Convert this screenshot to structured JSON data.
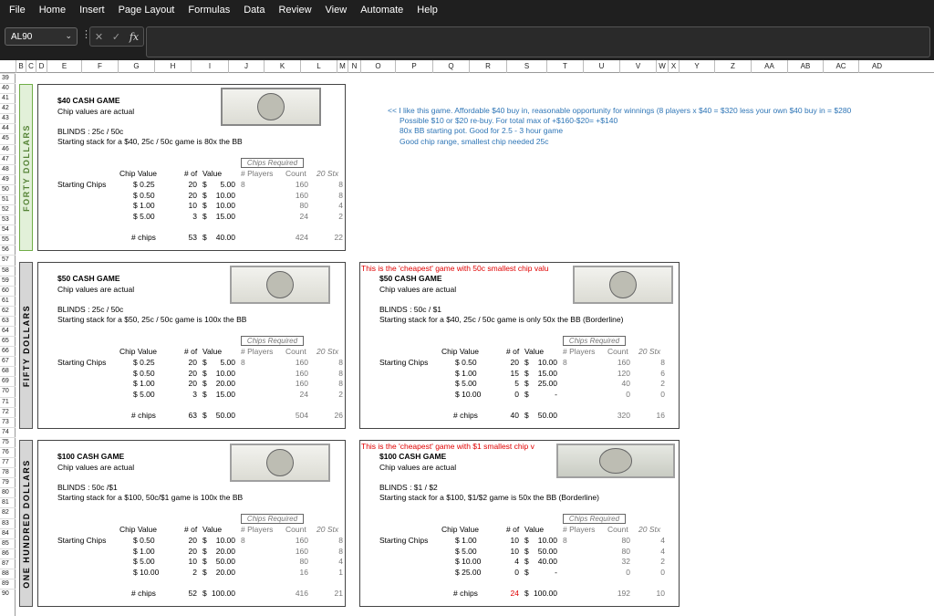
{
  "menu": [
    "File",
    "Home",
    "Insert",
    "Page Layout",
    "Formulas",
    "Data",
    "Review",
    "View",
    "Automate",
    "Help"
  ],
  "formula_bar": {
    "name_box": "AL90",
    "fx_label": "fx"
  },
  "columns": [
    "B",
    "C",
    "D",
    "E",
    "F",
    "G",
    "H",
    "I",
    "J",
    "K",
    "L",
    "M",
    "N",
    "O",
    "P",
    "Q",
    "R",
    "S",
    "T",
    "U",
    "V",
    "W",
    "X",
    "Y",
    "Z",
    "AA",
    "AB",
    "AC",
    "AD"
  ],
  "rows": [
    "39",
    "40",
    "41",
    "42",
    "43",
    "44",
    "45",
    "46",
    "47",
    "48",
    "49",
    "50",
    "51",
    "52",
    "53",
    "54",
    "55",
    "56",
    "57",
    "58",
    "59",
    "60",
    "61",
    "62",
    "63",
    "64",
    "65",
    "66",
    "67",
    "68",
    "69",
    "70",
    "71",
    "72",
    "73",
    "74",
    "75",
    "76",
    "77",
    "78",
    "79",
    "80",
    "81",
    "82",
    "83",
    "84",
    "85",
    "86",
    "87",
    "88",
    "89",
    "90"
  ],
  "sections": {
    "forty": "FORTY DOLLARS",
    "fifty": "FIFTY DOLLARS",
    "hundred": "ONE HUNDRED DOLLARS"
  },
  "common": {
    "chips_required": "Chips Required",
    "chip_value": "Chip Value",
    "num_of": "# of",
    "value": "Value",
    "num_players": "# Players",
    "count": "Count",
    "stx": "20 Stx",
    "starting_chips": "Starting Chips",
    "num_chips": "# chips",
    "chip_values_actual": "Chip values are actual"
  },
  "games": {
    "g40": {
      "title": "$40 CASH GAME",
      "blinds": "BLINDS :  25c / 50c",
      "stack": "Starting stack for a $40, 25c / 50c  game is 80x the BB",
      "players": "8",
      "rows": [
        {
          "cv": "$  0.25",
          "n": "20",
          "v": "5.00",
          "c": "160",
          "s": "8"
        },
        {
          "cv": "$  0.50",
          "n": "20",
          "v": "10.00",
          "c": "160",
          "s": "8"
        },
        {
          "cv": "$  1.00",
          "n": "10",
          "v": "10.00",
          "c": "80",
          "s": "4"
        },
        {
          "cv": "$  5.00",
          "n": "3",
          "v": "15.00",
          "c": "24",
          "s": "2"
        }
      ],
      "total": {
        "n": "53",
        "v": "40.00",
        "c": "424",
        "s": "22"
      }
    },
    "g50a": {
      "title": "$50 CASH GAME",
      "blinds": "BLINDS :  25c / 50c",
      "stack": "Starting stack for a $50, 25c / 50c  game is 100x the BB",
      "players": "8",
      "rows": [
        {
          "cv": "$  0.25",
          "n": "20",
          "v": "5.00",
          "c": "160",
          "s": "8"
        },
        {
          "cv": "$  0.50",
          "n": "20",
          "v": "10.00",
          "c": "160",
          "s": "8"
        },
        {
          "cv": "$  1.00",
          "n": "20",
          "v": "20.00",
          "c": "160",
          "s": "8"
        },
        {
          "cv": "$  5.00",
          "n": "3",
          "v": "15.00",
          "c": "24",
          "s": "2"
        }
      ],
      "total": {
        "n": "63",
        "v": "50.00",
        "c": "504",
        "s": "26"
      }
    },
    "g50b": {
      "note": "This is the 'cheapest' game with 50c smallest chip valu",
      "title": "$50 CASH GAME",
      "blinds": "BLINDS :  50c / $1",
      "stack": "Starting stack for a $40, 25c / 50c  game is only 50x the BB (Borderline)",
      "players": "8",
      "rows": [
        {
          "cv": "$  0.50",
          "n": "20",
          "v": "10.00",
          "c": "160",
          "s": "8"
        },
        {
          "cv": "$  1.00",
          "n": "15",
          "v": "15.00",
          "c": "120",
          "s": "6"
        },
        {
          "cv": "$  5.00",
          "n": "5",
          "v": "25.00",
          "c": "40",
          "s": "2"
        },
        {
          "cv": "$ 10.00",
          "n": "0",
          "v": "-",
          "c": "0",
          "s": "0"
        }
      ],
      "total": {
        "n": "40",
        "v": "50.00",
        "c": "320",
        "s": "16"
      }
    },
    "g100a": {
      "title": "$100 CASH GAME",
      "blinds": "BLINDS :  50c  /$1",
      "stack": "Starting stack for a $100, 50c/$1  game is 100x the BB",
      "players": "8",
      "rows": [
        {
          "cv": "$  0.50",
          "n": "20",
          "v": "10.00",
          "c": "160",
          "s": "8"
        },
        {
          "cv": "$  1.00",
          "n": "20",
          "v": "20.00",
          "c": "160",
          "s": "8"
        },
        {
          "cv": "$  5.00",
          "n": "10",
          "v": "50.00",
          "c": "80",
          "s": "4"
        },
        {
          "cv": "$ 10.00",
          "n": "2",
          "v": "20.00",
          "c": "16",
          "s": "1"
        }
      ],
      "total": {
        "n": "52",
        "v": "100.00",
        "c": "416",
        "s": "21"
      }
    },
    "g100b": {
      "note": "This is the 'cheapest' game with $1 smallest chip v",
      "title": "$100 CASH GAME",
      "blinds": "BLINDS :  $1 / $2",
      "stack": "Starting stack for a $100, $1/$2  game is 50x the BB (Borderline)",
      "players": "8",
      "rows": [
        {
          "cv": "$  1.00",
          "n": "10",
          "v": "10.00",
          "c": "80",
          "s": "4"
        },
        {
          "cv": "$  5.00",
          "n": "10",
          "v": "50.00",
          "c": "80",
          "s": "4"
        },
        {
          "cv": "$ 10.00",
          "n": "4",
          "v": "40.00",
          "c": "32",
          "s": "2"
        },
        {
          "cv": "$ 25.00",
          "n": "0",
          "v": "-",
          "c": "0",
          "s": "0"
        }
      ],
      "total": {
        "n": "24",
        "v": "100.00",
        "c": "192",
        "s": "10"
      }
    }
  },
  "comment_lines": [
    "<< I like this game.    Affordable $40 buy in, reasonable opportunity for winnings (8 players x $40 = $320 less your own $40 buy in = $280",
    "Possible $10 or $20 re-buy. For total max of +$160-$20= +$140",
    "80x BB starting pot.  Good for 2.5 - 3 hour game",
    "Good chip range, smallest chip needed 25c"
  ],
  "colors": {
    "note_red": "#e00000",
    "comment_blue": "#2e75b6",
    "forty_green": "#70ad47"
  }
}
